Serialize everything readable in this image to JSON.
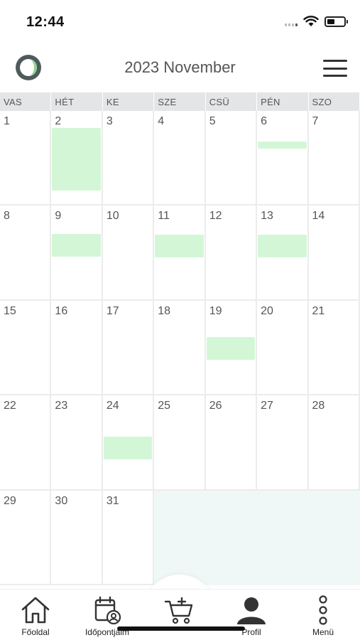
{
  "status_bar": {
    "time": "12:44",
    "icons": [
      "signal-icon",
      "wifi-icon",
      "battery-icon"
    ],
    "battery_level": 0.45
  },
  "header": {
    "title": "2023 November",
    "logo_icon": "app-logo-icon",
    "menu_icon": "hamburger-menu-icon"
  },
  "calendar": {
    "weekdays": [
      "VAS",
      "HÉT",
      "KE",
      "SZE",
      "CSÜ",
      "PÉN",
      "SZO"
    ],
    "days": [
      "1",
      "2",
      "3",
      "4",
      "5",
      "6",
      "7",
      "8",
      "9",
      "10",
      "11",
      "12",
      "13",
      "14",
      "15",
      "16",
      "17",
      "18",
      "19",
      "20",
      "21",
      "22",
      "23",
      "24",
      "25",
      "26",
      "27",
      "28",
      "29",
      "30",
      "31"
    ],
    "days_with_events": [
      "2",
      "6",
      "9",
      "11",
      "13",
      "19",
      "24"
    ],
    "colors": {
      "event": "#d3f7d6",
      "header_bg": "#e3e5e6",
      "empty_cell": "#f0f7f7"
    }
  },
  "tab_bar": {
    "tabs": [
      {
        "label": "Főoldal",
        "icon": "home-icon"
      },
      {
        "label": "Időpontjaim",
        "icon": "calendar-user-icon"
      },
      {
        "label": "",
        "icon": "cart-plus-icon"
      },
      {
        "label": "Profil",
        "icon": "user-icon"
      },
      {
        "label": "Menü",
        "icon": "more-vertical-icon"
      }
    ]
  }
}
